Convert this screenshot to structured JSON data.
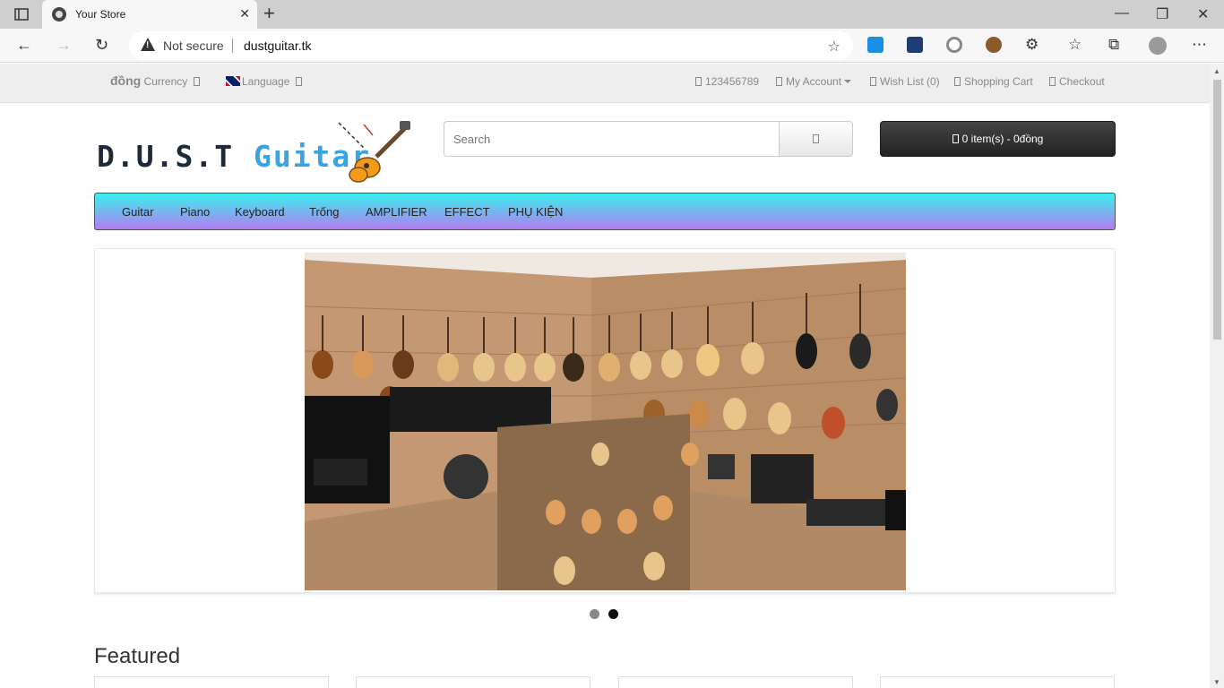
{
  "browser": {
    "tab_title": "Your Store",
    "security_label": "Not secure",
    "url": "dustguitar.tk"
  },
  "topbar": {
    "currency_symbol": "đồng",
    "currency_label": "Currency",
    "language_label": "Language",
    "phone": "123456789",
    "my_account": "My Account",
    "wishlist": "Wish List (0)",
    "shopping_cart": "Shopping Cart",
    "checkout": "Checkout"
  },
  "logo": {
    "part1": "D.U.S.T",
    "part2": "Guitar"
  },
  "search": {
    "placeholder": "Search"
  },
  "cart": {
    "summary": "0 item(s) - 0đồng"
  },
  "menu": {
    "items": [
      "Guitar",
      "Piano",
      "Keyboard",
      "Trống",
      "AMPLIFIER",
      "EFFECT",
      "PHỤ KIỆN"
    ]
  },
  "carousel": {
    "slide_count": 2,
    "active_index": 1
  },
  "featured": {
    "heading": "Featured"
  },
  "colors": {
    "menu_gradient_top": "#39f0ef",
    "menu_gradient_bottom": "#b37cf0",
    "logo_dark": "#1d2a3a",
    "logo_blue": "#3aa3e3",
    "cart_button": "#2b2b2b"
  }
}
